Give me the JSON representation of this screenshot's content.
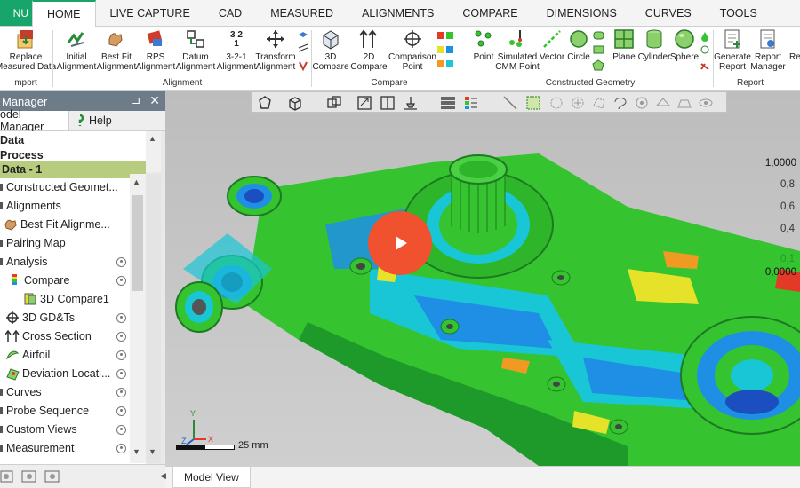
{
  "menubar": {
    "menu_label": "NU",
    "tabs": [
      "HOME",
      "LIVE CAPTURE",
      "CAD",
      "MEASURED",
      "ALIGNMENTS",
      "COMPARE",
      "DIMENSIONS",
      "CURVES",
      "TOOLS"
    ],
    "active_tab": "HOME"
  },
  "ribbon": {
    "import": {
      "replace_l1": "Replace",
      "replace_l2": "Measured Data",
      "group": "mport"
    },
    "alignment": {
      "initial_l1": "Initial",
      "initial_l2": "Alignment",
      "bestfit_l1": "Best Fit",
      "bestfit_l2": "Alignment",
      "rps_l1": "RPS",
      "rps_l2": "Alignment",
      "datum_l1": "Datum",
      "datum_l2": "Alignment",
      "three21_icon": "3 2\n1",
      "three21_l1": "3-2-1",
      "three21_l2": "Alignment",
      "transform_l1": "Transform",
      "transform_l2": "Alignment",
      "group": "Alignment"
    },
    "compare": {
      "c3d_l1": "3D",
      "c3d_l2": "Compare",
      "c2d_l1": "2D",
      "c2d_l2": "Compare",
      "cp_l1": "Comparison",
      "cp_l2": "Point",
      "group": "Compare"
    },
    "constructed": {
      "point": "Point",
      "sim_l1": "Simulated",
      "sim_l2": "CMM Point",
      "vector": "Vector",
      "circle": "Circle",
      "plane": "Plane",
      "cylinder": "Cylinder",
      "sphere": "Sphere",
      "group": "Constructed Geometry"
    },
    "report": {
      "gen_l1": "Generate",
      "gen_l2": "Report",
      "mgr_l1": "Report",
      "mgr_l2": "Manager",
      "group": "Report",
      "cut": "Reg"
    }
  },
  "left_panel": {
    "title": "Manager",
    "tab_model": "odel Manager",
    "tab_help": "Help",
    "tree": [
      {
        "label": "Data",
        "bold": true
      },
      {
        "label": "Process",
        "bold": true
      },
      {
        "label": "Data - 1",
        "bold": true,
        "highlight": true
      },
      {
        "label": "Constructed Geomet..."
      },
      {
        "label": "Alignments"
      },
      {
        "label": "Best Fit Alignme..."
      },
      {
        "label": "Pairing Map"
      },
      {
        "label": "Analysis"
      },
      {
        "label": "Compare"
      },
      {
        "label": "3D Compare1"
      },
      {
        "label": "3D GD&Ts"
      },
      {
        "label": "Cross Section"
      },
      {
        "label": "Airfoil"
      },
      {
        "label": "Deviation Locati..."
      },
      {
        "label": "Curves"
      },
      {
        "label": "Probe Sequence"
      },
      {
        "label": "Custom Views"
      },
      {
        "label": "Measurement"
      }
    ]
  },
  "viewport": {
    "legend": [
      "1,0000",
      "0,8",
      "0,6",
      "0,4",
      "0,1",
      "0,0000"
    ],
    "scale_label": "25 mm",
    "axes": {
      "x": "X",
      "y": "Y",
      "z": "Z"
    },
    "colors": {
      "green": "#35c42f",
      "blue": "#1f8fe6",
      "cyan": "#19c6d6",
      "yellow": "#e6e22a",
      "orange": "#f09a24",
      "red": "#e23a26",
      "play": "#f0512e"
    }
  },
  "status": {
    "tab": "Model View"
  }
}
